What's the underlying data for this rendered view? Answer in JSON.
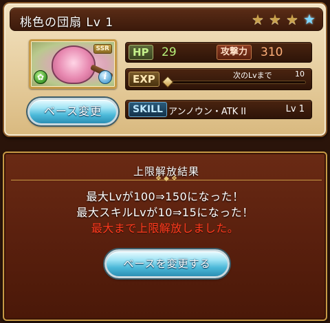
{
  "item": {
    "title": "桃色の団扇 Lv 1",
    "rarity_badge": "SSR",
    "stars": [
      {
        "kind": "gold"
      },
      {
        "kind": "gold"
      },
      {
        "kind": "gold"
      },
      {
        "kind": "blue"
      }
    ],
    "element_icon": "wind-element-icon",
    "info_icon": "info-icon"
  },
  "stats": {
    "hp_label": "HP",
    "hp_value": "29",
    "atk_label": "攻撃力",
    "atk_value": "310",
    "exp_label": "EXP",
    "next_label": "次のLvまで",
    "next_value": "10",
    "exp_progress": 0.0
  },
  "skill": {
    "label": "SKILL",
    "name": "アンノウン・ATK II",
    "level": "Lv 1"
  },
  "buttons": {
    "base_change": "ベース変更",
    "change_base": "ベースを変更する"
  },
  "result": {
    "title": "上限解放結果",
    "line1": "最大Lvが100⇒150になった！",
    "line2": "最大スキルLvが10⇒15になった！",
    "line3": "最大まで上限解放しました。"
  },
  "colors": {
    "star_gold": "#caa24d",
    "star_blue": "#7fd8ff",
    "hp_green": "#b6f07a",
    "atk_orange": "#ffb07a",
    "notice_red": "#ff3b1e",
    "button_cyan": "#4cb9d9"
  }
}
